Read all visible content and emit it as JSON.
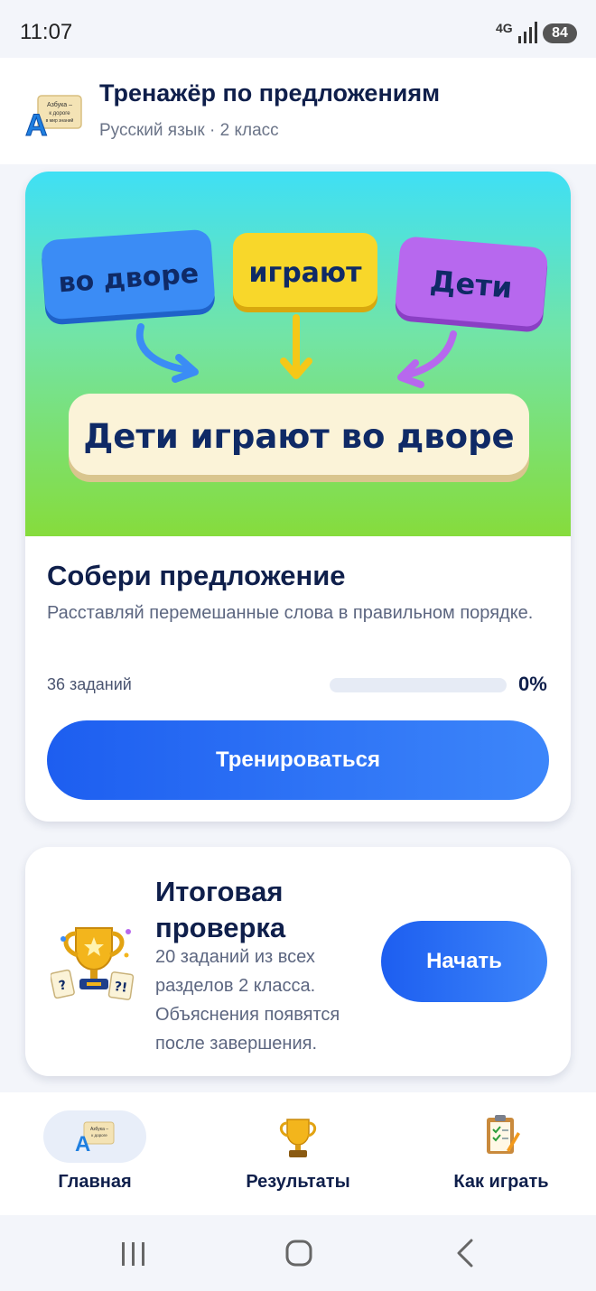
{
  "status_bar": {
    "time": "11:07",
    "network": "4G",
    "battery": "84"
  },
  "header": {
    "logo_text": "Азбука – к дороге в мир знаний",
    "logo_letter": "А",
    "title": "Тренажёр по предложениям",
    "subtitle": "Русский язык · 2 класс"
  },
  "main_card": {
    "hero": {
      "words": [
        "во дворе",
        "играют",
        "Дети"
      ],
      "sentence": "Дети играют во дворе",
      "colors": {
        "blue": "#2f7ff2",
        "yellow": "#f7d21a",
        "purple": "#b35ee8",
        "sentence_bg": "#faf3dc"
      }
    },
    "title": "Собери предложение",
    "description": "Расставляй перемешанные слова в правильном порядке.",
    "tasks_count": "36 заданий",
    "progress_percent": 0,
    "progress_label": "0%",
    "button_label": "Тренироваться"
  },
  "final_card": {
    "title": "Итоговая проверка",
    "description": "20 заданий из всех разделов 2 класса. Объяснения появятся после завершения.",
    "button_label": "Начать",
    "icon": "trophy-icon"
  },
  "bottom_nav": {
    "items": [
      {
        "label": "Главная",
        "icon": "abc-book-icon",
        "active": true
      },
      {
        "label": "Результаты",
        "icon": "trophy-icon",
        "active": false
      },
      {
        "label": "Как играть",
        "icon": "clipboard-icon",
        "active": false
      }
    ]
  },
  "colors": {
    "accent": "#2f6cf6",
    "text_dark": "#0f1f4b",
    "text_muted": "#5c6680"
  }
}
